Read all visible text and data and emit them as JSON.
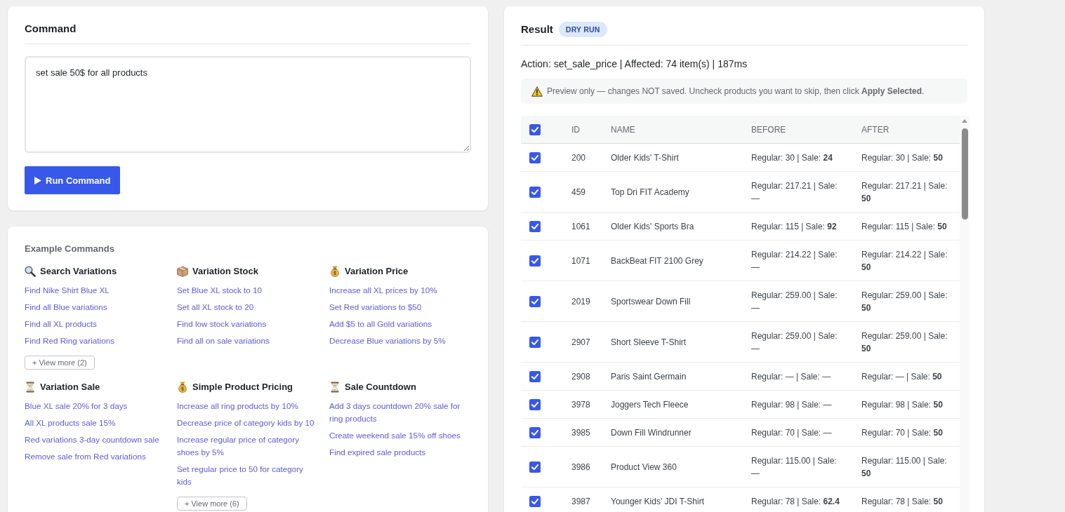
{
  "command": {
    "title": "Command",
    "value": "set sale 50$ for all products",
    "button": "Run Command"
  },
  "examples": {
    "title": "Example Commands",
    "groups": [
      {
        "kind": "search",
        "title": "Search Variations",
        "items": [
          "Find Nike Shirt Blue XL",
          "Find all Blue variations",
          "Find all XL products",
          "Find Red Ring variations"
        ],
        "more": "+ View more (2)"
      },
      {
        "kind": "stock",
        "title": "Variation Stock",
        "items": [
          "Set Blue XL stock to 10",
          "Set all XL stock to 20",
          "Find low stock variations",
          "Find all on sale variations"
        ]
      },
      {
        "kind": "price",
        "title": "Variation Price",
        "items": [
          "Increase all XL prices by 10%",
          "Set Red variations to $50",
          "Add $5 to all Gold variations",
          "Decrease Blue variations by 5%"
        ]
      },
      {
        "kind": "timer",
        "title": "Variation Sale",
        "items": [
          "Blue XL sale 20% for 3 days",
          "All XL products sale 15%",
          "Red variations 3-day countdown sale",
          "Remove sale from Red variations"
        ]
      },
      {
        "kind": "price",
        "title": "Simple Product Pricing",
        "items": [
          "Increase all ring products by 10%",
          "Decrease price of category kids by 10",
          "Increase regular price of category shoes by 5%",
          "Set regular price to 50 for category kids"
        ],
        "more": "+ View more (6)"
      },
      {
        "kind": "timer",
        "title": "Sale Countdown",
        "items": [
          "Add 3 days countdown 20% sale for ring products",
          "Create weekend sale 15% off shoes",
          "Find expired sale products"
        ]
      }
    ]
  },
  "result": {
    "title": "Result",
    "badge": "DRY RUN",
    "summary": "Action: set_sale_price | Affected: 74 item(s) | 187ms",
    "notice": "Preview only — changes NOT saved. Uncheck products you want to skip, then click **Apply Selected**.",
    "table": {
      "all_checked": true,
      "columns": [
        "ID",
        "NAME",
        "BEFORE",
        "AFTER"
      ],
      "rows": [
        {
          "checked": true,
          "id": "200",
          "name": "Older Kids' T-Shirt",
          "before": "Regular: 30 | Sale: **24**",
          "after": "Regular: 30 | Sale: **50**"
        },
        {
          "checked": true,
          "id": "459",
          "name": "Top Dri FIT Academy",
          "before": "Regular: 217.21 | Sale: —",
          "after": "Regular: 217.21 | Sale: **50**"
        },
        {
          "checked": true,
          "id": "1061",
          "name": "Older Kids' Sports Bra",
          "before": "Regular: 115 | Sale: **92**",
          "after": "Regular: 115 | Sale: **50**"
        },
        {
          "checked": true,
          "id": "1071",
          "name": "BackBeat FIT 2100 Grey",
          "before": "Regular: 214.22 | Sale: —",
          "after": "Regular: 214.22 | Sale: **50**"
        },
        {
          "checked": true,
          "id": "2019",
          "name": "Sportswear Down Fill",
          "before": "Regular: 259.00 | Sale: —",
          "after": "Regular: 259.00 | Sale: **50**"
        },
        {
          "checked": true,
          "id": "2907",
          "name": "Short Sleeve T-Shirt",
          "before": "Regular: 259.00 | Sale: —",
          "after": "Regular: 259.00 | Sale: **50**"
        },
        {
          "checked": true,
          "id": "2908",
          "name": "Paris Saint Germain",
          "before": "Regular: — | Sale: —",
          "after": "Regular: — | Sale: **50**"
        },
        {
          "checked": true,
          "id": "3978",
          "name": "Joggers Tech Fleece",
          "before": "Regular: 98 | Sale: —",
          "after": "Regular: 98 | Sale: **50**"
        },
        {
          "checked": true,
          "id": "3985",
          "name": "Down Fill Windrunner",
          "before": "Regular: 70 | Sale: —",
          "after": "Regular: 70 | Sale: **50**"
        },
        {
          "checked": true,
          "id": "3986",
          "name": "Product View 360",
          "before": "Regular: 115.00 | Sale: —",
          "after": "Regular: 115.00 | Sale: **50**"
        },
        {
          "checked": true,
          "id": "3987",
          "name": "Younger Kids' JDI T-Shirt",
          "before": "Regular: 78 | Sale: **62.4**",
          "after": "Regular: 78 | Sale: **50**"
        }
      ]
    }
  }
}
